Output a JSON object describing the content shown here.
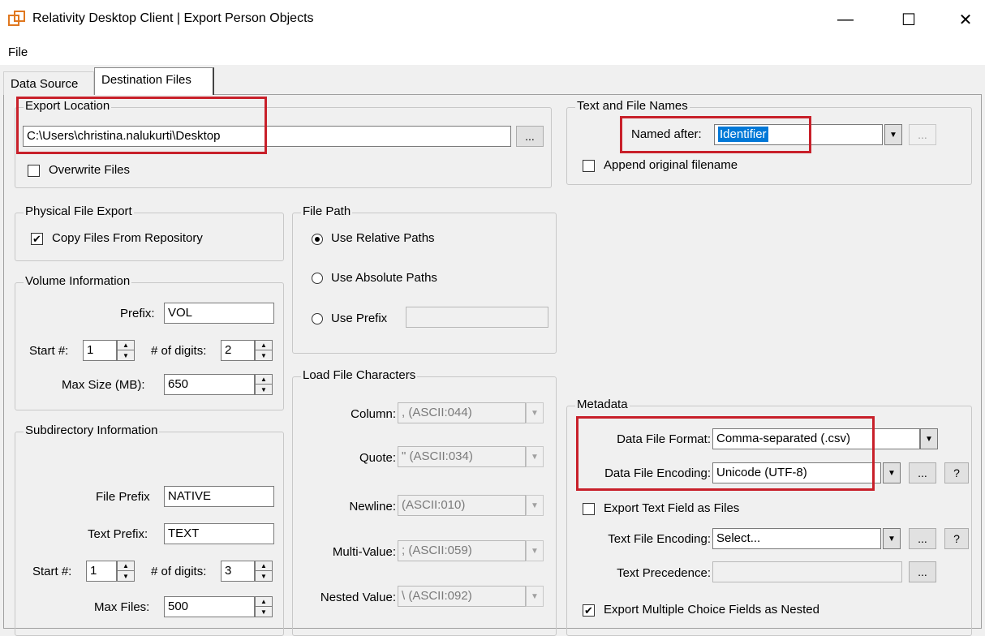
{
  "window": {
    "title": "Relativity Desktop Client | Export Person Objects",
    "minimize_icon": "—",
    "maximize_icon": "☐",
    "close_icon": "✕"
  },
  "menu": {
    "file": "File"
  },
  "tabs": [
    {
      "label": "Data Source"
    },
    {
      "label": "Destination Files"
    }
  ],
  "export_location": {
    "title": "Export Location",
    "path": "C:\\Users\\christina.nalukurti\\Desktop",
    "browse": "...",
    "overwrite_label": "Overwrite Files",
    "overwrite_checked": false
  },
  "text_file_names": {
    "title": "Text and File Names",
    "named_after_label": "Named after:",
    "named_after_value": "Identifier",
    "browse": "...",
    "append_label": "Append original filename",
    "append_checked": false
  },
  "physical_file_export": {
    "title": "Physical File Export",
    "copy_label": "Copy Files From Repository",
    "copy_checked": true,
    "check_mark": "✔"
  },
  "file_path": {
    "title": "File Path",
    "relative": "Use Relative Paths",
    "absolute": "Use Absolute Paths",
    "prefix": "Use Prefix",
    "prefix_value": "",
    "selected": "relative"
  },
  "volume_info": {
    "title": "Volume Information",
    "prefix_label": "Prefix:",
    "prefix_value": "VOL",
    "start_label": "Start #:",
    "start_value": "1",
    "digits_label": "# of digits:",
    "digits_value": "2",
    "maxsize_label": "Max Size (MB):",
    "maxsize_value": "650"
  },
  "load_file_chars": {
    "title": "Load File Characters",
    "rows": [
      {
        "label": "Column:",
        "value": ", (ASCII:044)"
      },
      {
        "label": "Quote:",
        "value": "\" (ASCII:034)"
      },
      {
        "label": "Newline:",
        "value": " (ASCII:010)"
      },
      {
        "label": "Multi-Value:",
        "value": "; (ASCII:059)"
      },
      {
        "label": "Nested Value:",
        "value": "\\ (ASCII:092)"
      }
    ]
  },
  "subdirectory_info": {
    "title": "Subdirectory Information",
    "file_prefix_label": "File Prefix",
    "file_prefix_value": "NATIVE",
    "text_prefix_label": "Text Prefix:",
    "text_prefix_value": "TEXT",
    "start_label": "Start #:",
    "start_value": "1",
    "digits_label": "# of digits:",
    "digits_value": "3",
    "maxfiles_label": "Max Files:",
    "maxfiles_value": "500"
  },
  "metadata": {
    "title": "Metadata",
    "format_label": "Data File Format:",
    "format_value": "Comma-separated (.csv)",
    "encoding_label": "Data File Encoding:",
    "encoding_value": "Unicode (UTF-8)",
    "browse": "...",
    "help": "?",
    "export_text_label": "Export Text Field as Files",
    "export_text_checked": false,
    "text_encoding_label": "Text File Encoding:",
    "text_encoding_value": "Select...",
    "text_precedence_label": "Text Precedence:",
    "text_precedence_value": "",
    "export_multi_label": "Export Multiple Choice Fields as Nested",
    "export_multi_checked": true
  },
  "colors": {
    "highlight": "#c8202a",
    "selection": "#0078d7"
  }
}
